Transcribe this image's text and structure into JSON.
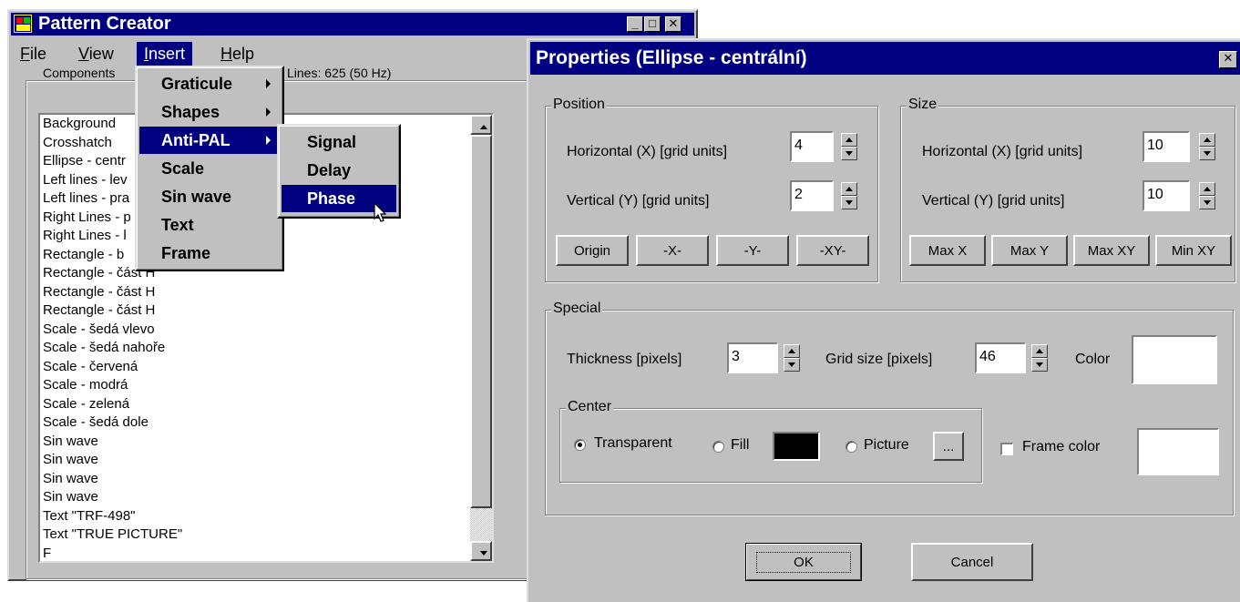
{
  "main_window": {
    "title": "Pattern Creator",
    "icon_text": "Pattern Creator",
    "menubar": [
      "File",
      "View",
      "Insert",
      "Help"
    ],
    "active_menu": "Insert",
    "components_label": "Components",
    "lines_info": "Lines: 625 (50 Hz)",
    "components": [
      "Background",
      "Crosshatch",
      "Ellipse - centr",
      "Left lines - lev",
      "Left lines - pra",
      "Right Lines - p",
      "Right Lines - l",
      "Rectangle - b",
      "Rectangle - část H",
      "Rectangle - část H",
      "Rectangle - část H",
      "Scale - šedá vlevo",
      "Scale - šedá nahoře",
      "Scale - červená",
      "Scale - modrá",
      "Scale - zelená",
      "Scale - šedá dole",
      "Sin wave",
      "Sin wave",
      "Sin wave",
      "Sin wave",
      "Text  \"TRF-498\"",
      "Text \"TRUE PICTURE\"",
      "F"
    ]
  },
  "insert_menu": {
    "items": [
      {
        "label": "Graticule",
        "submenu": true
      },
      {
        "label": "Shapes",
        "submenu": true
      },
      {
        "label": "Anti-PAL",
        "submenu": true,
        "highlighted": true
      },
      {
        "label": "Scale",
        "submenu": false
      },
      {
        "label": "Sin wave",
        "submenu": false
      },
      {
        "label": "Text",
        "submenu": false
      },
      {
        "label": "Frame",
        "submenu": false
      }
    ]
  },
  "antipal_submenu": {
    "items": [
      {
        "label": "Signal"
      },
      {
        "label": "Delay"
      },
      {
        "label": "Phase",
        "highlighted": true
      }
    ]
  },
  "dialog": {
    "title": "Properties (Ellipse - centrální)",
    "position": {
      "legend": "Position",
      "horizontal_label": "Horizontal (X)   [grid units]",
      "horizontal_value": "4",
      "vertical_label": "Vertical (Y)   [grid units]",
      "vertical_value": "2",
      "buttons": [
        "Origin",
        "-X-",
        "-Y-",
        "-XY-"
      ]
    },
    "size": {
      "legend": "Size",
      "horizontal_label": "Horizontal (X)   [grid units]",
      "horizontal_value": "10",
      "vertical_label": "Vertical (Y)   [grid units]",
      "vertical_value": "10",
      "buttons": [
        "Max X",
        "Max Y",
        "Max XY",
        "Min XY"
      ]
    },
    "special": {
      "legend": "Special",
      "thickness_label": "Thickness   [pixels]",
      "thickness_value": "3",
      "grid_size_label": "Grid size   [pixels]",
      "grid_size_value": "46",
      "color_label": "Color",
      "color_value": "#ffffff",
      "center": {
        "legend": "Center",
        "transparent_label": "Transparent",
        "transparent_checked": true,
        "fill_label": "Fill",
        "fill_color": "#000000",
        "picture_label": "Picture",
        "browse_label": "..."
      },
      "frame_color_label": "Frame color",
      "frame_color_checked": false,
      "frame_color_value": "#ffffff"
    },
    "ok_label": "OK",
    "cancel_label": "Cancel"
  },
  "colors": {
    "titlebar": "#000080",
    "face": "#c0c0c0",
    "highlight": "#000080"
  }
}
